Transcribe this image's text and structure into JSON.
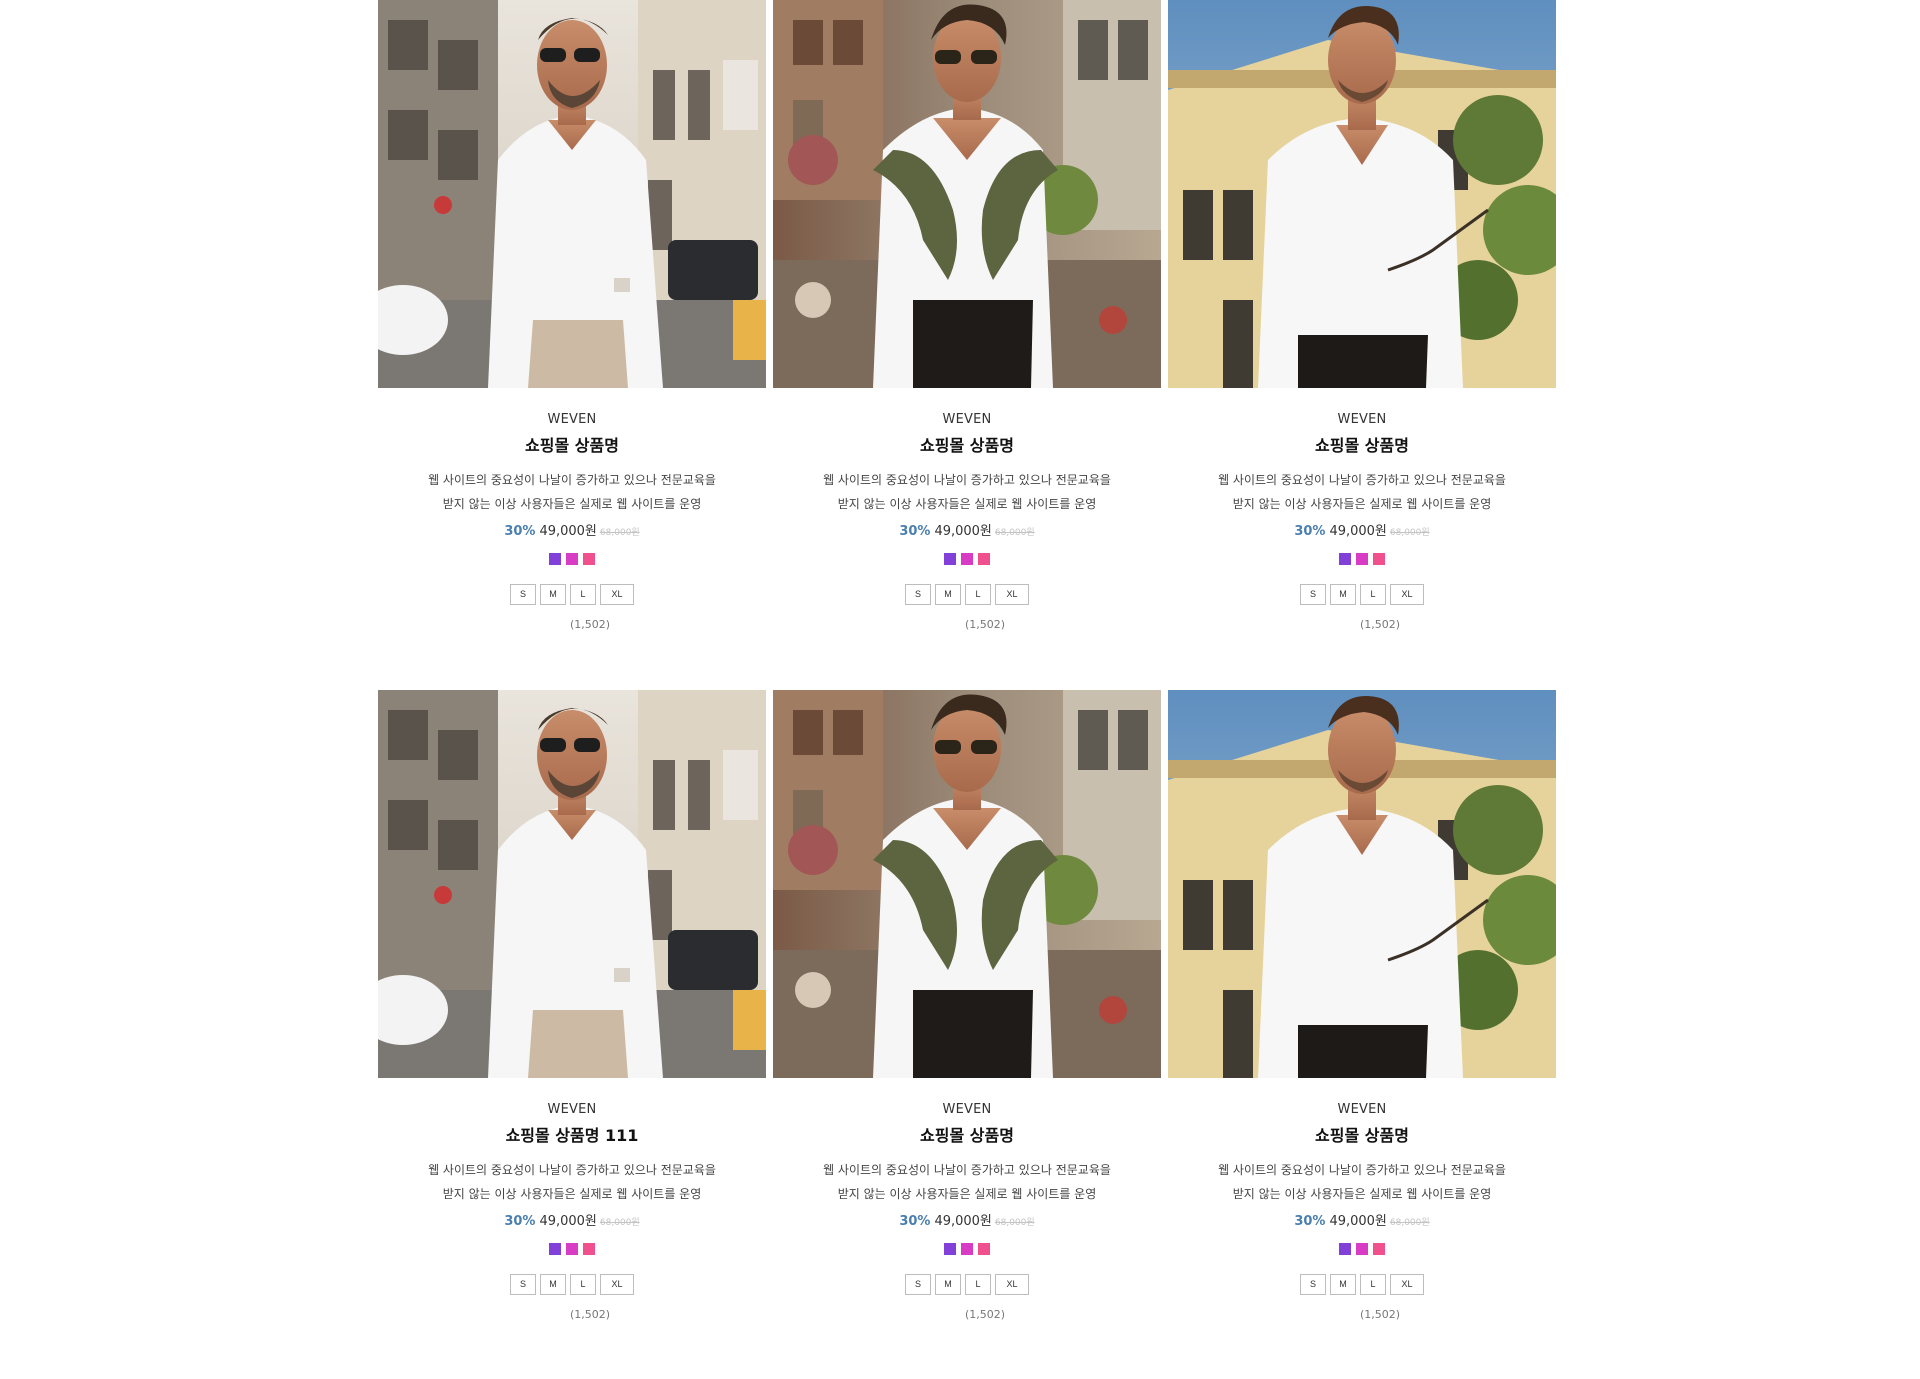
{
  "colors": {
    "discount": "#4a7fb0",
    "swatch_purple": "#8340d8",
    "swatch_magenta": "#d83cc4",
    "swatch_pink": "#f0508e"
  },
  "products": [
    {
      "image": "model-photo-1",
      "brand": "WEVEN",
      "name": "쇼핑몰 상품명",
      "desc_line1": "웹 사이트의 중요성이 나날이 증가하고 있으나 전문교육을",
      "desc_line2": "받지 않는 이상 사용자들은 실제로 웹 사이트를 운영",
      "discount": "30%",
      "price": "49,000원",
      "original_price": "68,000원",
      "swatches": [
        "#8340d8",
        "#d83cc4",
        "#f0508e"
      ],
      "sizes": [
        "S",
        "M",
        "L",
        "XL"
      ],
      "reviews": "(1,502)"
    },
    {
      "image": "model-photo-2",
      "brand": "WEVEN",
      "name": "쇼핑몰 상품명",
      "desc_line1": "웹 사이트의 중요성이 나날이 증가하고 있으나 전문교육을",
      "desc_line2": "받지 않는 이상 사용자들은 실제로 웹 사이트를 운영",
      "discount": "30%",
      "price": "49,000원",
      "original_price": "68,000원",
      "swatches": [
        "#8340d8",
        "#d83cc4",
        "#f0508e"
      ],
      "sizes": [
        "S",
        "M",
        "L",
        "XL"
      ],
      "reviews": "(1,502)"
    },
    {
      "image": "model-photo-3",
      "brand": "WEVEN",
      "name": "쇼핑몰 상품명",
      "desc_line1": "웹 사이트의 중요성이 나날이 증가하고 있으나 전문교육을",
      "desc_line2": "받지 않는 이상 사용자들은 실제로 웹 사이트를 운영",
      "discount": "30%",
      "price": "49,000원",
      "original_price": "68,000원",
      "swatches": [
        "#8340d8",
        "#d83cc4",
        "#f0508e"
      ],
      "sizes": [
        "S",
        "M",
        "L",
        "XL"
      ],
      "reviews": "(1,502)"
    },
    {
      "image": "model-photo-1",
      "brand": "WEVEN",
      "name": "쇼핑몰 상품명 111",
      "desc_line1": "웹 사이트의 중요성이 나날이 증가하고 있으나 전문교육을",
      "desc_line2": "받지 않는 이상 사용자들은 실제로 웹 사이트를 운영",
      "discount": "30%",
      "price": "49,000원",
      "original_price": "68,000원",
      "swatches": [
        "#8340d8",
        "#d83cc4",
        "#f0508e"
      ],
      "sizes": [
        "S",
        "M",
        "L",
        "XL"
      ],
      "reviews": "(1,502)"
    },
    {
      "image": "model-photo-2",
      "brand": "WEVEN",
      "name": "쇼핑몰 상품명",
      "desc_line1": "웹 사이트의 중요성이 나날이 증가하고 있으나 전문교육을",
      "desc_line2": "받지 않는 이상 사용자들은 실제로 웹 사이트를 운영",
      "discount": "30%",
      "price": "49,000원",
      "original_price": "68,000원",
      "swatches": [
        "#8340d8",
        "#d83cc4",
        "#f0508e"
      ],
      "sizes": [
        "S",
        "M",
        "L",
        "XL"
      ],
      "reviews": "(1,502)"
    },
    {
      "image": "model-photo-3",
      "brand": "WEVEN",
      "name": "쇼핑몰 상품명",
      "desc_line1": "웹 사이트의 중요성이 나날이 증가하고 있으나 전문교육을",
      "desc_line2": "받지 않는 이상 사용자들은 실제로 웹 사이트를 운영",
      "discount": "30%",
      "price": "49,000원",
      "original_price": "68,000원",
      "swatches": [
        "#8340d8",
        "#d83cc4",
        "#f0508e"
      ],
      "sizes": [
        "S",
        "M",
        "L",
        "XL"
      ],
      "reviews": "(1,502)"
    }
  ]
}
